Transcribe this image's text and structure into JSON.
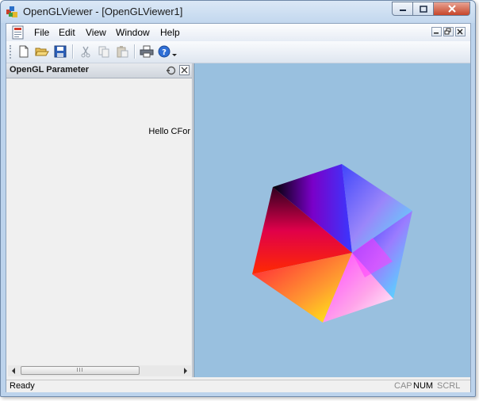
{
  "window": {
    "title": "OpenGLViewer - [OpenGLViewer1]",
    "caption_buttons": [
      "minimize",
      "maximize",
      "close"
    ]
  },
  "menubar": {
    "items": [
      "File",
      "Edit",
      "View",
      "Window",
      "Help"
    ],
    "mdi_buttons": [
      "minimize",
      "restore",
      "close"
    ]
  },
  "toolbar": {
    "buttons": [
      "new-icon",
      "open-icon",
      "save-icon",
      "cut-icon",
      "copy-icon",
      "paste-icon",
      "print-icon",
      "help-icon",
      "dropdown-arrow-icon"
    ]
  },
  "panel": {
    "title": "OpenGL Parameter",
    "content_text": "Hello CFor",
    "scroll_thumb": "III"
  },
  "viewport": {
    "background": "#99c0df"
  },
  "statusbar": {
    "status": "Ready",
    "indicators": {
      "cap": "CAP",
      "num": "NUM",
      "scrl": "SCRL"
    }
  },
  "colors": {
    "accent": "#bcd3ec",
    "close_button": "#c7452a",
    "viewport_bg": "#99c0df"
  }
}
